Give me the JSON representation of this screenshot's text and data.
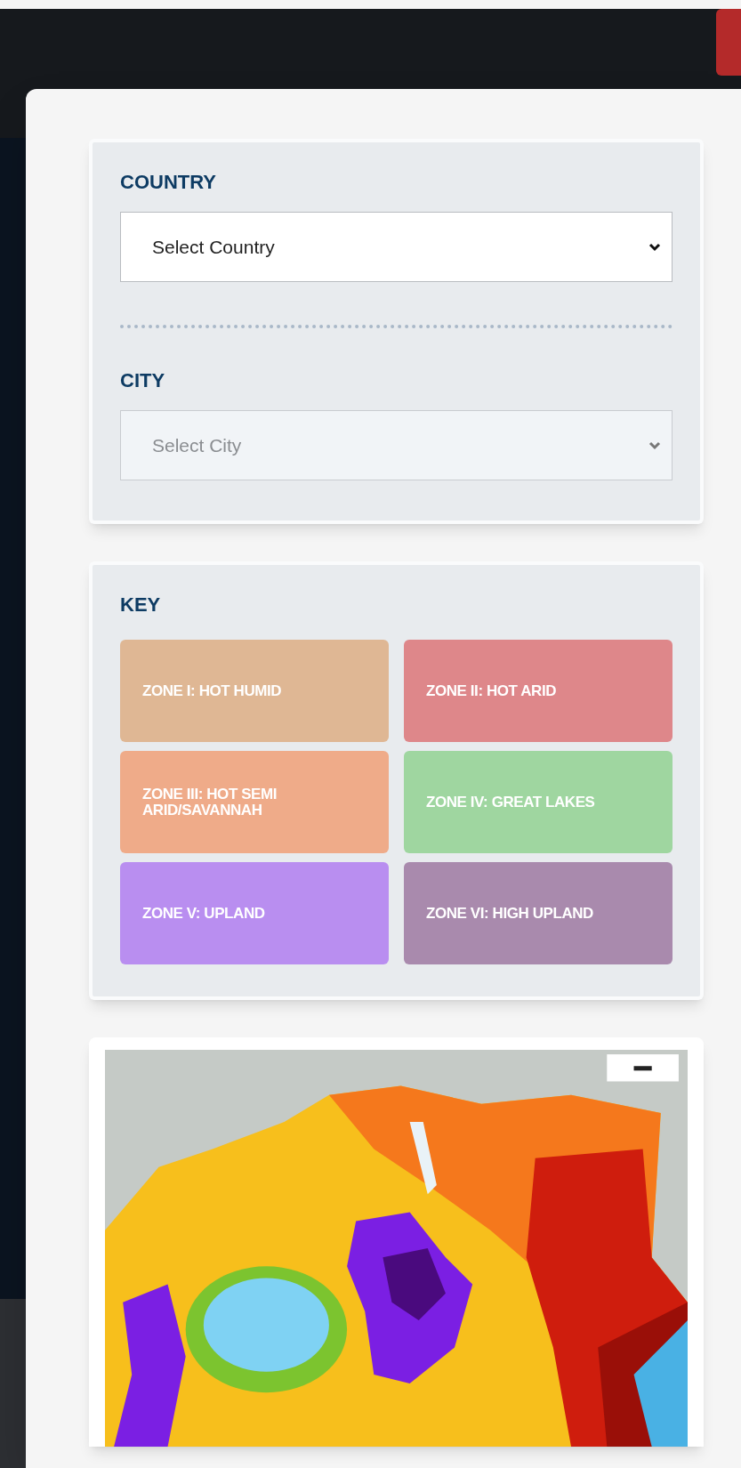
{
  "filters": [
    {
      "label": "COUNTRY",
      "value": "Select Country",
      "disabled": false
    },
    {
      "label": "CITY",
      "value": "Select City",
      "disabled": true
    }
  ],
  "key": {
    "title": "KEY",
    "zones": [
      {
        "label": "ZONE I: HOT HUMID",
        "color": "#dfb794"
      },
      {
        "label": "ZONE II: HOT ARID",
        "color": "#de878a"
      },
      {
        "label": "ZONE III: HOT SEMI ARID/SAVANNAH",
        "color": "#efab89"
      },
      {
        "label": "ZONE IV: GREAT LAKES",
        "color": "#9fd6a0"
      },
      {
        "label": "ZONE V: UPLAND",
        "color": "#b98ef0"
      },
      {
        "label": "ZONE VI: HIGH UPLAND",
        "color": "#a98aad"
      }
    ]
  }
}
